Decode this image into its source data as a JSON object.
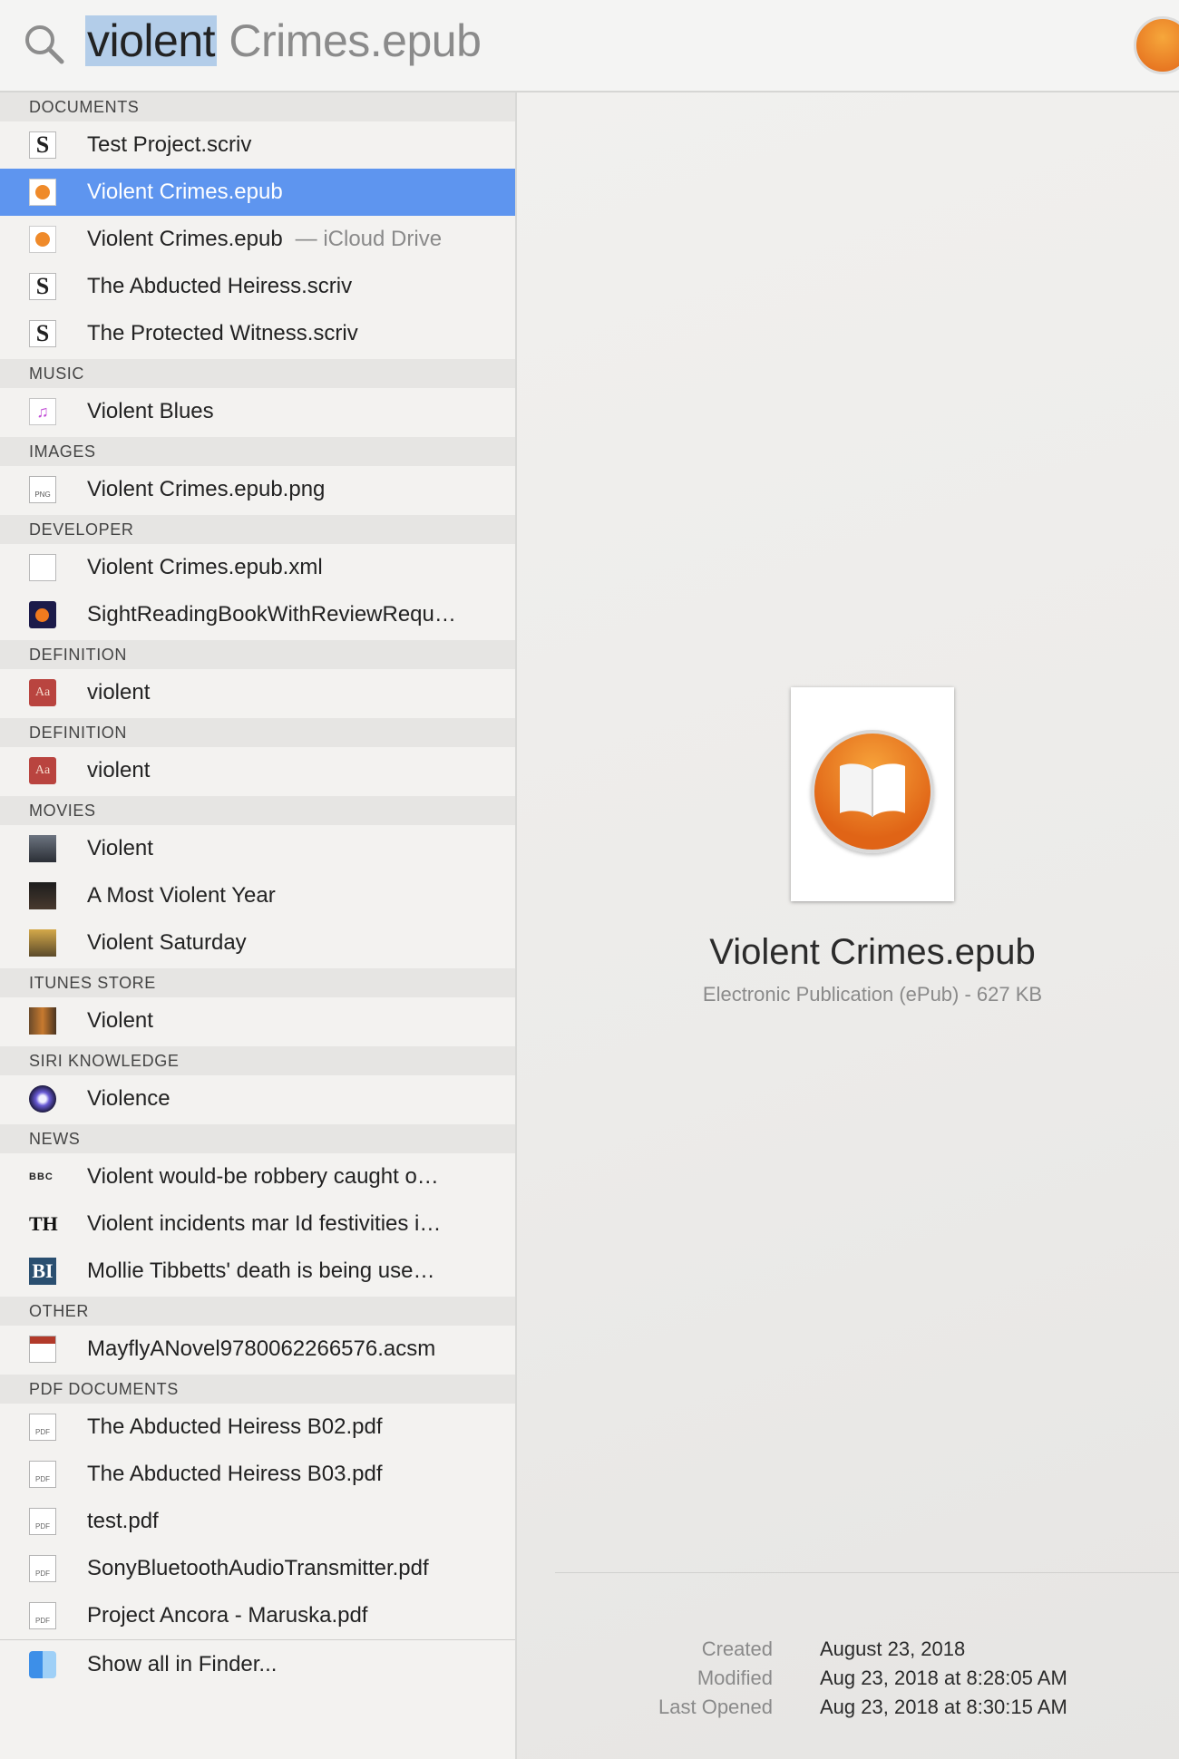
{
  "search": {
    "query_highlight": "violent",
    "query_rest": " Crimes.epub"
  },
  "sections": [
    {
      "title": "DOCUMENTS",
      "items": [
        {
          "label": "Test Project.scriv",
          "icon": "scrivener-icon"
        },
        {
          "label": "Violent Crimes.epub",
          "icon": "epub-icon",
          "selected": true
        },
        {
          "label": "Violent Crimes.epub",
          "sub": "— iCloud Drive",
          "icon": "epub-icon"
        },
        {
          "label": "The Abducted Heiress.scriv",
          "icon": "scrivener-icon"
        },
        {
          "label": "The Protected Witness.scriv",
          "icon": "scrivener-icon"
        }
      ]
    },
    {
      "title": "MUSIC",
      "items": [
        {
          "label": "Violent Blues",
          "icon": "music-file-icon"
        }
      ]
    },
    {
      "title": "IMAGES",
      "items": [
        {
          "label": "Violent Crimes.epub.png",
          "icon": "png-file-icon"
        }
      ]
    },
    {
      "title": "DEVELOPER",
      "items": [
        {
          "label": "Violent Crimes.epub.xml",
          "icon": "blank-document-icon"
        },
        {
          "label": "SightReadingBookWithReviewRequ…",
          "icon": "firefox-document-icon"
        }
      ]
    },
    {
      "title": "DEFINITION",
      "items": [
        {
          "label": "violent",
          "icon": "dictionary-icon"
        }
      ]
    },
    {
      "title": "DEFINITION",
      "items": [
        {
          "label": "violent",
          "icon": "dictionary-icon"
        }
      ]
    },
    {
      "title": "MOVIES",
      "items": [
        {
          "label": "Violent",
          "icon": "movie-poster-icon"
        },
        {
          "label": "A Most Violent Year",
          "icon": "movie-poster-icon"
        },
        {
          "label": "Violent Saturday",
          "icon": "movie-poster-icon"
        }
      ]
    },
    {
      "title": "ITUNES STORE",
      "items": [
        {
          "label": "Violent",
          "icon": "album-art-icon"
        }
      ]
    },
    {
      "title": "SIRI KNOWLEDGE",
      "items": [
        {
          "label": "Violence",
          "icon": "siri-icon"
        }
      ]
    },
    {
      "title": "NEWS",
      "items": [
        {
          "label": "Violent would-be robbery caught o…",
          "icon": "bbc-logo-icon",
          "icon_text": "BBC"
        },
        {
          "label": "Violent incidents mar Id festivities i…",
          "icon": "the-hindu-logo-icon",
          "icon_text": "TH"
        },
        {
          "label": "Mollie Tibbetts' death is being use…",
          "icon": "business-insider-logo-icon",
          "icon_text": "BI"
        }
      ]
    },
    {
      "title": "OTHER",
      "items": [
        {
          "label": "MayflyANovel9780062266576.acsm",
          "icon": "acsm-file-icon"
        }
      ]
    },
    {
      "title": "PDF DOCUMENTS",
      "items": [
        {
          "label": "The Abducted Heiress B02.pdf",
          "icon": "pdf-file-icon"
        },
        {
          "label": "The Abducted Heiress B03.pdf",
          "icon": "pdf-file-icon"
        },
        {
          "label": "test.pdf",
          "icon": "pdf-file-icon"
        },
        {
          "label": "SonyBluetoothAudioTransmitter.pdf",
          "icon": "pdf-file-icon"
        },
        {
          "label": "Project Ancora - Maruska.pdf",
          "icon": "pdf-file-icon"
        }
      ]
    }
  ],
  "show_all": {
    "label": "Show all in Finder...",
    "icon": "finder-icon"
  },
  "preview": {
    "title": "Violent Crimes.epub",
    "subtitle": "Electronic Publication (ePub) - 627 KB",
    "meta": [
      {
        "key": "Created",
        "value": "August 23, 2018"
      },
      {
        "key": "Modified",
        "value": "Aug 23, 2018 at 8:28:05 AM"
      },
      {
        "key": "Last Opened",
        "value": "Aug 23, 2018 at 8:30:15 AM"
      }
    ]
  },
  "colors": {
    "selection": "#5e95ef",
    "query_highlight": "#b3cde9",
    "books_orange": "#e8731c"
  }
}
